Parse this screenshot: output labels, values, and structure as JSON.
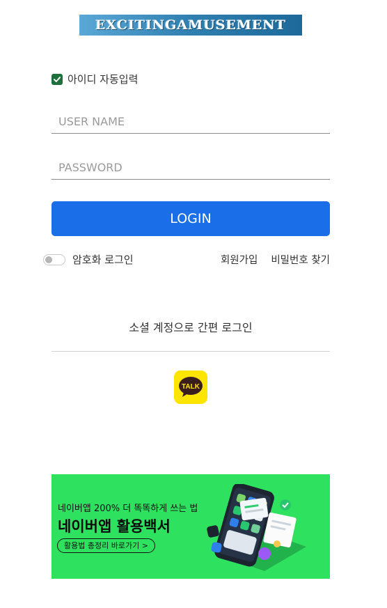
{
  "logo": {
    "text": "EXCITINGAMUSEMENT"
  },
  "auto_fill": {
    "label": "아이디 자동입력",
    "checked": true
  },
  "username": {
    "placeholder": "USER NAME",
    "value": ""
  },
  "password": {
    "placeholder": "PASSWORD",
    "value": ""
  },
  "login_button": {
    "label": "LOGIN"
  },
  "encrypted_login": {
    "label": "암호화 로그인",
    "enabled": false
  },
  "links": {
    "signup": "회원가입",
    "find_password": "비밀번호 찾기"
  },
  "social": {
    "title": "소셜 계정으로 간편 로그인",
    "kakao_label": "TALK"
  },
  "banner": {
    "subtitle": "네이버앱 200% 더 똑똑하게 쓰는 법",
    "title": "네이버앱 활용백서",
    "button": "활용법 총정리 바로가기 >"
  },
  "colors": {
    "primary": "#1a6ee8",
    "checkbox": "#1f6f3a",
    "kakao": "#fee500",
    "banner_bg": "#2ee25f"
  }
}
